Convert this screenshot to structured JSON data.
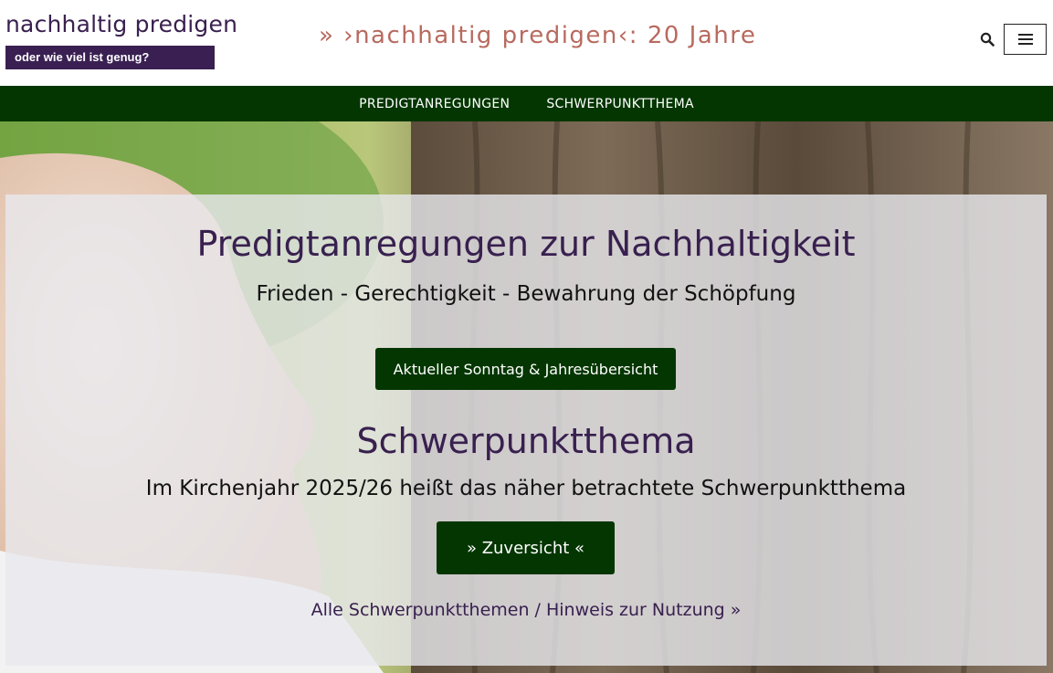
{
  "header": {
    "site_title": "nachhaltig predigen",
    "tagline": "oder wie viel ist genug?",
    "promo": "» ›nachhaltig predigen‹: 20 Jahre",
    "search_icon": "search-icon",
    "menu_icon": "hamburger-menu-icon"
  },
  "nav": {
    "items": [
      {
        "label": "PREDIGTANREGUNGEN"
      },
      {
        "label": "SCHWERPUNKTTHEMA"
      }
    ]
  },
  "hero": {
    "title": "Predigtanregungen zur Nachhaltigkeit",
    "subtitle": "Frieden - Gerechtigkeit - Bewahrung der Schöpfung",
    "button_current": "Aktueller Sonntag & Jahresübersicht",
    "focus_title": "Schwerpunktthema",
    "focus_text": "Im Kirchenjahr 2025/26 heißt das näher betrachtete Schwerpunktthema",
    "button_focus": "» Zuversicht «",
    "all_topics_link": "Alle Schwerpunktthemen / Hinweis zur Nutzung »"
  },
  "colors": {
    "brand_purple": "#3a2052",
    "nav_green": "#033600",
    "promo_rose": "#b86a5f"
  }
}
